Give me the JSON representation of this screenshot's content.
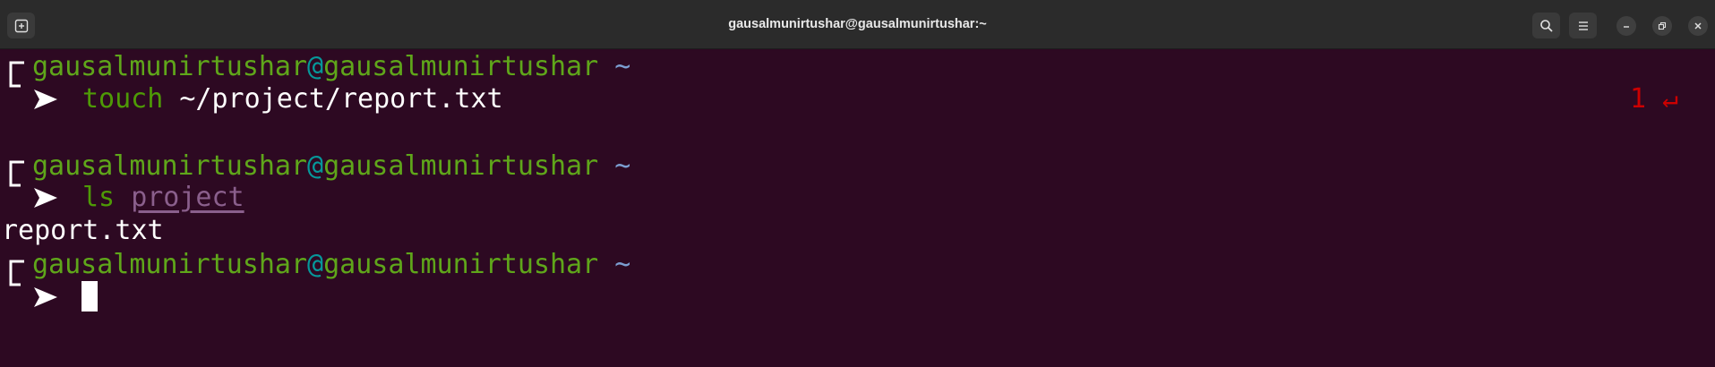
{
  "window": {
    "title": "gausalmunirtushar@gausalmunirtushar:~"
  },
  "icons": {
    "new_tab": "new-tab-icon",
    "search": "search-icon",
    "menu": "hamburger-menu-icon",
    "minimize": "minimize-icon",
    "maximize": "restore-icon",
    "close": "close-icon"
  },
  "colors": {
    "background": "#2d0922",
    "titlebar": "#2b2b2b",
    "user": "#4e9a06",
    "at": "#06989a",
    "tilde": "#7c9ed1",
    "error": "#cc0000"
  },
  "prompt": {
    "user": "gausalmunirtushar",
    "at": "@",
    "host": "gausalmunirtushar",
    "dir": "~"
  },
  "blocks": [
    {
      "command": "touch",
      "argument": " ~/project/report.txt",
      "exit_code": "1",
      "return_glyph": "↵"
    },
    {
      "command": "ls",
      "argument": "project",
      "output": "report.txt"
    },
    {
      "command": "",
      "argument": ""
    }
  ]
}
